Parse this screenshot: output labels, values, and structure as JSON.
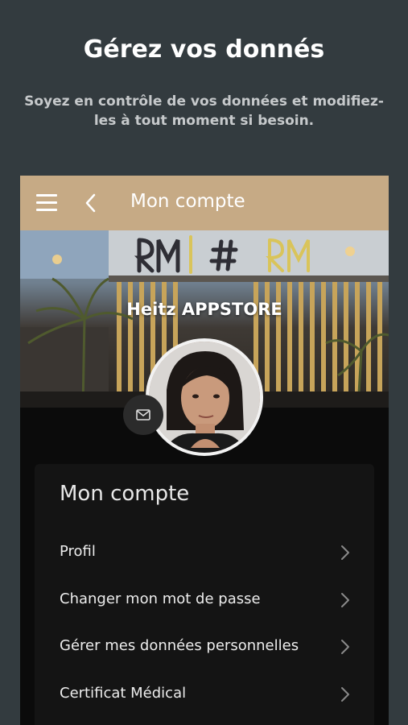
{
  "promo": {
    "headline": "Gérez vos donnés",
    "subline": "Soyez en contrôle de vos données et modifiez-les à tout moment si besoin."
  },
  "appbar": {
    "title": "Mon compte",
    "menu_icon": "hamburger-menu-icon",
    "back_icon": "chevron-left-icon",
    "background": "#c6aa85"
  },
  "profile": {
    "name": "Heitz  APPSTORE",
    "building_sign": "RM #beRM",
    "mail_icon": "envelope-icon"
  },
  "account": {
    "title": "Mon compte",
    "items": [
      {
        "label": "Profil"
      },
      {
        "label": "Changer mon mot de passe"
      },
      {
        "label": "Gérer mes données personnelles"
      },
      {
        "label": "Certificat Médical"
      }
    ]
  },
  "colors": {
    "page_bg": "#333b3f",
    "card_bg": "#141414",
    "accent": "#c6aa85"
  }
}
